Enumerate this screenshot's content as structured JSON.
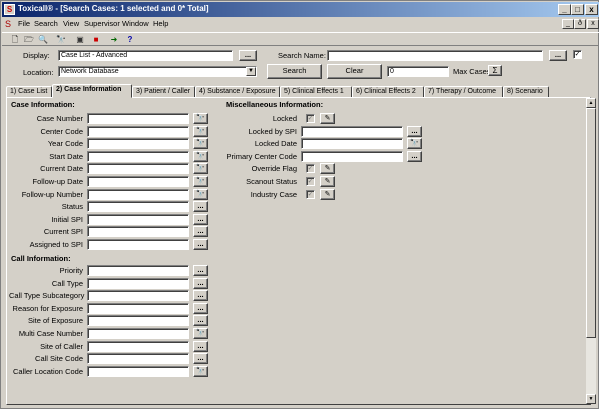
{
  "window": {
    "app_name": "Toxicall®",
    "title": " - [Search Cases: 1 selected and 0* Total]",
    "min": "_",
    "restore": "□",
    "close": "x"
  },
  "menu": [
    "File",
    "Search",
    "View",
    "Supervisor",
    "Window",
    "Help"
  ],
  "mdi_controls": {
    "min": "_",
    "restore": "ð",
    "close": "x"
  },
  "toolbar_icons": [
    "new-icon",
    "open-icon",
    "find-icon",
    "binoculars-icon",
    "print-preview-icon",
    "cancel-icon",
    "exit-icon",
    "help-icon"
  ],
  "toolbar_glyphs": [
    "🗋",
    "🗁",
    "🔍",
    "🔭",
    "▣",
    "■",
    "➜",
    "?"
  ],
  "search": {
    "display_label": "Display:",
    "display_value": "Case List - Advanced",
    "location_label": "Location:",
    "location_value": "Network Database",
    "search_name_label": "Search Name:",
    "search_name_value": "",
    "search_button": "Search",
    "clear_button": "Clear",
    "count_value": "0",
    "max_cases_label": "Max Cases",
    "sigma": "Σ",
    "ellipsis": "...",
    "check": "✓"
  },
  "tabs": [
    "1) Case List",
    "2) Case Information",
    "3) Patient / Caller",
    "4) Substance / Exposure",
    "5) Clinical Effects 1",
    "6) Clinical Effects 2",
    "7) Therapy / Outcome",
    "8) Scenario"
  ],
  "active_tab": 1,
  "case_info": {
    "heading": "Case Information:",
    "fields": [
      {
        "label": "Case Number",
        "btn": "binoc"
      },
      {
        "label": "Center Code",
        "btn": "binoc"
      },
      {
        "label": "Year Code",
        "btn": "binoc"
      },
      {
        "label": "Start Date",
        "btn": "binoc"
      },
      {
        "label": "Current Date",
        "btn": "binoc"
      },
      {
        "label": "Follow-up Date",
        "btn": "binoc"
      },
      {
        "label": "Follow-up Number",
        "btn": "binoc"
      },
      {
        "label": "Status",
        "btn": "dots"
      },
      {
        "label": "Initial SPI",
        "btn": "dots"
      },
      {
        "label": "Current SPI",
        "btn": "dots"
      },
      {
        "label": "Assigned to SPI",
        "btn": "dots"
      }
    ]
  },
  "call_info": {
    "heading": "Call Information:",
    "fields": [
      {
        "label": "Priority",
        "btn": "dots"
      },
      {
        "label": "Call Type",
        "btn": "dots"
      },
      {
        "label": "Call Type Subcategory",
        "btn": "dots"
      },
      {
        "label": "Reason for Exposure",
        "btn": "dots"
      },
      {
        "label": "Site of Exposure",
        "btn": "dots"
      },
      {
        "label": "Multi Case Number",
        "btn": "binoc"
      },
      {
        "label": "Site of Caller",
        "btn": "dots"
      },
      {
        "label": "Call Site Code",
        "btn": "dots"
      },
      {
        "label": "Caller Location Code",
        "btn": "binoc"
      }
    ]
  },
  "misc_info": {
    "heading": "Miscellaneous Information:",
    "fields": [
      {
        "label": "Locked",
        "kind": "check"
      },
      {
        "label": "Locked by SPI",
        "kind": "text",
        "btn": "dots"
      },
      {
        "label": "Locked Date",
        "kind": "text",
        "btn": "binoc"
      },
      {
        "label": "Primary Center Code",
        "kind": "text",
        "btn": "dots"
      },
      {
        "label": "Override Flag",
        "kind": "check"
      },
      {
        "label": "Scanout Status",
        "kind": "check"
      },
      {
        "label": "Industry Case",
        "kind": "check"
      }
    ]
  },
  "glyphs": {
    "binoc": "🔭",
    "dots": "...",
    "eraser": "✎",
    "checkmark": "✓",
    "scroll_up": "▲",
    "scroll_down": "▼",
    "dropdown": "▼"
  }
}
